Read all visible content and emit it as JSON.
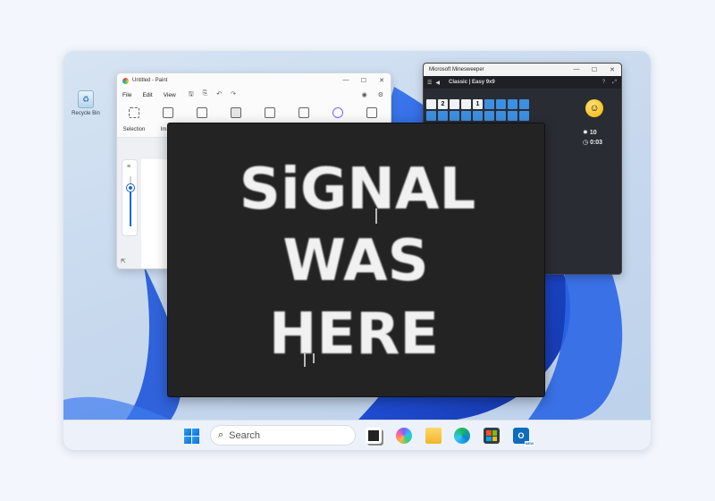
{
  "desktop": {
    "icon_label": "Recycle Bin"
  },
  "paint": {
    "title": "Untitled - Paint",
    "menu": [
      "File",
      "Edit",
      "View"
    ],
    "ribbon": [
      "Selection",
      "Image"
    ]
  },
  "minesweeper": {
    "title": "Microsoft Minesweeper",
    "mode": "Classic | Easy 9x9",
    "mines": "10",
    "time": "0:03",
    "revealed": [
      null,
      "2",
      null,
      null,
      "1",
      null,
      null,
      null,
      null
    ]
  },
  "graffiti": {
    "lines": [
      "SiGNAL",
      "WAS",
      "HERE"
    ]
  },
  "taskbar": {
    "search_placeholder": "Search",
    "outlook_badge": "NEW"
  },
  "colors": {
    "accent": "#0f6cbd",
    "bloom": "#1a4fd6",
    "graffiti_bg": "#232323"
  }
}
